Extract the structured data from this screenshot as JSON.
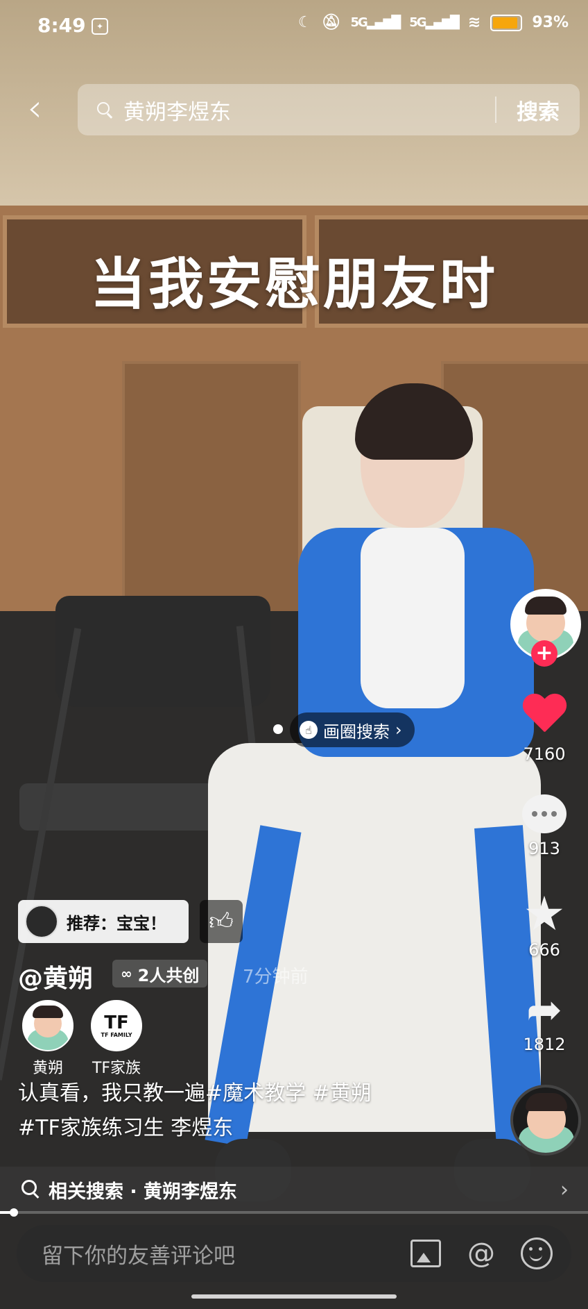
{
  "status_bar": {
    "time": "8:49",
    "signal_1": "5G",
    "signal_2": "5G",
    "battery_percent": "93%",
    "battery_level": 0.93,
    "accent": "#f6a60c"
  },
  "search": {
    "query": "黄朔李煜东",
    "button_label": "搜索",
    "back_icon": "chevron-left-icon"
  },
  "video": {
    "overlay_text": "当我安慰朋友时",
    "progress": 0.02
  },
  "actions": {
    "likes": "7160",
    "comments": "913",
    "favorites": "666",
    "shares": "1812",
    "follow_label": "+",
    "like_color": "#fe2c55"
  },
  "circle_search": {
    "label": "画圈搜索",
    "chevron": "›"
  },
  "recommendation": {
    "label": "推荐：宝宝！"
  },
  "author": {
    "handle": "@黄朔",
    "cocreate_label": "2人共创",
    "time_ago": "7分钟前"
  },
  "creators": [
    {
      "name": "黄朔"
    },
    {
      "name": "TF家族",
      "logo_text": "TF",
      "logo_sub": "TF FAMILY"
    }
  ],
  "caption": {
    "line1": "认真看，我只教一遍#魔术教学 #黄朔",
    "line2": "#TF家族练习生 李煜东"
  },
  "related_search": {
    "label": "相关搜索 · 黄朔李煜东",
    "chevron": "›"
  },
  "comment_bar": {
    "placeholder": "留下你的友善评论吧",
    "at_symbol": "@"
  }
}
